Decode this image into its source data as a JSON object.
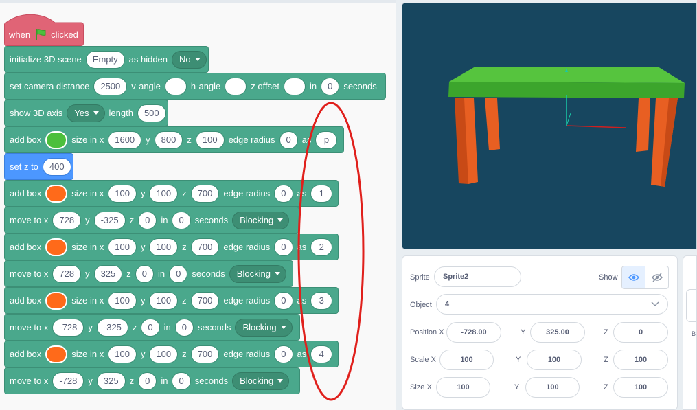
{
  "hat": {
    "when": "when",
    "clicked": "clicked",
    "flag_icon": "green-flag-icon"
  },
  "init_block": {
    "label": "initialize 3D scene",
    "scene": "Empty",
    "as_hidden": "as hidden",
    "hidden_value": "No"
  },
  "camera_block": {
    "label": "set camera distance",
    "distance": "2500",
    "v_angle": "v-angle",
    "v_value": "",
    "h_angle": "h-angle",
    "h_value": "",
    "z_offset": "z offset",
    "z_value": "",
    "in": "in",
    "seconds_value": "0",
    "seconds": "seconds"
  },
  "axis_block": {
    "label": "show 3D axis",
    "value": "Yes",
    "length_label": "length",
    "length": "500"
  },
  "box_p": {
    "label": "add box",
    "color": "#4cbf3c",
    "size_in_x": "size in x",
    "x": "1600",
    "y_label": "y",
    "y": "800",
    "z_label": "z",
    "z": "100",
    "edge_radius": "edge radius",
    "radius": "0",
    "as": "as",
    "name": "p"
  },
  "setz_block": {
    "label": "set z to",
    "value": "400"
  },
  "box_1": {
    "label": "add box",
    "color": "#ff6a1a",
    "size_in_x": "size in x",
    "x": "100",
    "y_label": "y",
    "y": "100",
    "z_label": "z",
    "z": "700",
    "edge_radius": "edge radius",
    "radius": "0",
    "as": "as",
    "name": "1"
  },
  "move_1": {
    "label": "move to x",
    "x": "728",
    "y_label": "y",
    "y": "-325",
    "z_label": "z",
    "z": "0",
    "in": "in",
    "secs": "0",
    "seconds": "seconds",
    "mode": "Blocking"
  },
  "box_2": {
    "label": "add box",
    "color": "#ff6a1a",
    "size_in_x": "size in x",
    "x": "100",
    "y_label": "y",
    "y": "100",
    "z_label": "z",
    "z": "700",
    "edge_radius": "edge radius",
    "radius": "0",
    "as": "as",
    "name": "2"
  },
  "move_2": {
    "label": "move to x",
    "x": "728",
    "y_label": "y",
    "y": "325",
    "z_label": "z",
    "z": "0",
    "in": "in",
    "secs": "0",
    "seconds": "seconds",
    "mode": "Blocking"
  },
  "box_3": {
    "label": "add box",
    "color": "#ff6a1a",
    "size_in_x": "size in x",
    "x": "100",
    "y_label": "y",
    "y": "100",
    "z_label": "z",
    "z": "700",
    "edge_radius": "edge radius",
    "radius": "0",
    "as": "as",
    "name": "3"
  },
  "move_3": {
    "label": "move to x",
    "x": "-728",
    "y_label": "y",
    "y": "-325",
    "z_label": "z",
    "z": "0",
    "in": "in",
    "secs": "0",
    "seconds": "seconds",
    "mode": "Blocking"
  },
  "box_4": {
    "label": "add box",
    "color": "#ff6a1a",
    "size_in_x": "size in x",
    "x": "100",
    "y_label": "y",
    "y": "100",
    "z_label": "z",
    "z": "700",
    "edge_radius": "edge radius",
    "radius": "0",
    "as": "as",
    "name": "4"
  },
  "move_4": {
    "label": "move to x",
    "x": "-728",
    "y_label": "y",
    "y": "325",
    "z_label": "z",
    "z": "0",
    "in": "in",
    "secs": "0",
    "seconds": "seconds",
    "mode": "Blocking"
  },
  "stage": {
    "background": "#17465f",
    "table_top_color": "#4cbf3c",
    "leg_color": "#ff6a1a"
  },
  "sprite_panel": {
    "sprite_label": "Sprite",
    "sprite_name": "Sprite2",
    "show_label": "Show",
    "show_icon": "eye-icon",
    "hide_icon": "eye-slash-icon",
    "object_label": "Object",
    "object_value": "4",
    "position_label": "Position X",
    "pos_x": "-728.00",
    "pos_y_label": "Y",
    "pos_y": "325.00",
    "pos_z_label": "Z",
    "pos_z": "0",
    "scale_label": "Scale X",
    "scale_x": "100",
    "scale_y_label": "Y",
    "scale_y": "100",
    "scale_z_label": "Z",
    "scale_z": "100",
    "size_label": "Size X",
    "size_x": "100",
    "size_y_label": "Y",
    "size_y": "100",
    "size_z_label": "Z",
    "size_z": "100"
  },
  "side_panel": {
    "partial_label": "Ba"
  },
  "annotation": {
    "color": "#e0201c"
  }
}
